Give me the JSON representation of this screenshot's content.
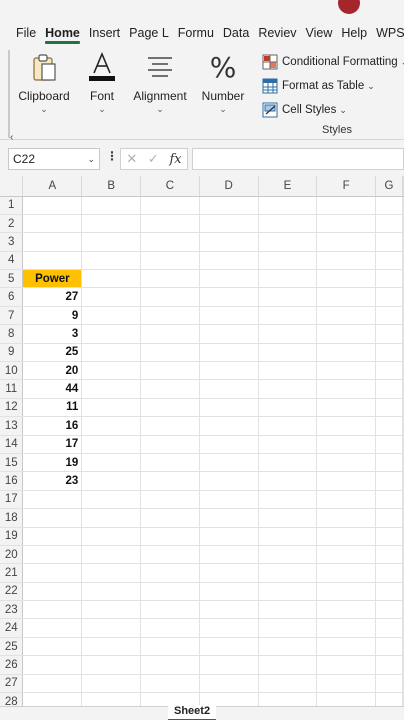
{
  "ribbon_tabs": [
    "File",
    "Home",
    "Insert",
    "Page L",
    "Formu",
    "Data",
    "Reviev",
    "View",
    "Help",
    "WPS P"
  ],
  "active_tab": "Home",
  "accent_color": "#217346",
  "ribbon": {
    "clipboard": "Clipboard",
    "font": "Font",
    "alignment": "Alignment",
    "number": "Number",
    "styles": {
      "conditional": "Conditional Formatting",
      "table": "Format as Table",
      "cell": "Cell Styles",
      "group_label": "Styles"
    }
  },
  "formula_bar": {
    "name_box": "C22",
    "fx": "fx",
    "cancel_icon": "close-icon",
    "enter_icon": "check-icon",
    "value": ""
  },
  "grid": {
    "columns": [
      "A",
      "B",
      "C",
      "D",
      "E",
      "F",
      "G"
    ],
    "row_numbers": [
      1,
      2,
      3,
      4,
      5,
      6,
      7,
      8,
      9,
      10,
      11,
      12,
      13,
      14,
      15,
      16,
      17,
      18,
      19,
      20,
      21,
      22,
      23,
      24,
      25,
      26,
      27,
      28
    ],
    "header_cell": "A5",
    "header_value": "Power",
    "header_fill": "#ffc000",
    "power_values": [
      27,
      9,
      3,
      25,
      20,
      44,
      11,
      16,
      17,
      19,
      23
    ]
  },
  "sheet_tabs": {
    "active": "Sheet2"
  }
}
